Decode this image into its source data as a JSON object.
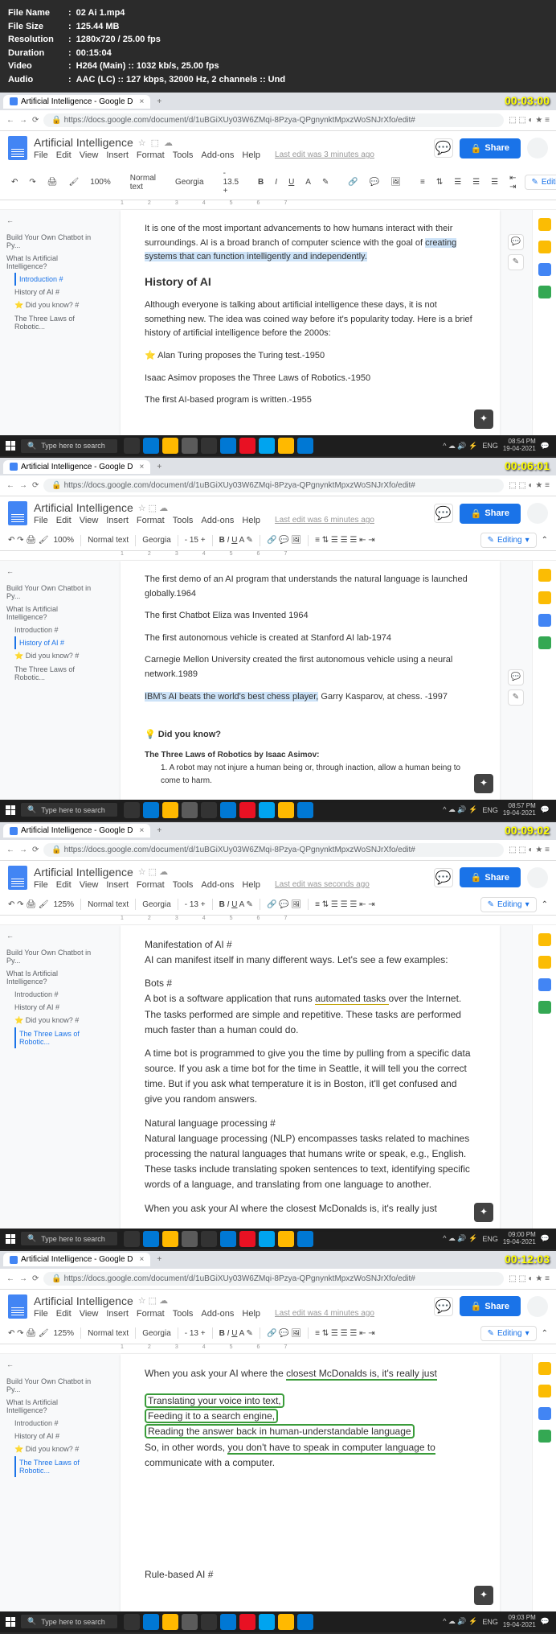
{
  "meta": {
    "file_name_label": "File Name",
    "file_name": "02 Ai 1.mp4",
    "file_size_label": "File Size",
    "file_size": "125.44 MB",
    "resolution_label": "Resolution",
    "resolution": "1280x720 / 25.00 fps",
    "duration_label": "Duration",
    "duration": "00:15:04",
    "video_label": "Video",
    "video": "H264 (Main) :: 1032 kb/s, 25.00 fps",
    "audio_label": "Audio",
    "audio": "AAC (LC) :: 127 kbps, 32000 Hz, 2 channels :: Und"
  },
  "timestamps": [
    "00:03:00",
    "00:06:01",
    "00:09:02",
    "00:12:03"
  ],
  "browser": {
    "tab_title": "Artificial Intelligence - Google D",
    "url": "https://docs.google.com/document/d/1uBGiXUy03W6ZMqi-8Pzya-QPgnynktMpxzWoSNJrXfo/edit#"
  },
  "docs": {
    "title": "Artificial Intelligence",
    "menu": [
      "File",
      "Edit",
      "View",
      "Insert",
      "Format",
      "Tools",
      "Add-ons",
      "Help"
    ],
    "last_edit": [
      "Last edit was 3 minutes ago",
      "Last edit was 6 minutes ago",
      "Last edit was seconds ago",
      "Last edit was 4 minutes ago"
    ],
    "share": "Share",
    "editing": "Editing",
    "zoom": [
      "100%",
      "100%",
      "125%",
      "125%"
    ],
    "style": "Normal text",
    "font": "Georgia",
    "size": [
      "13.5",
      "15",
      "13",
      "13"
    ]
  },
  "outline": {
    "items": [
      "Build Your Own Chatbot in Py...",
      "What Is Artificial Intelligence?",
      "Introduction #",
      "History of AI #",
      "Did you know? #",
      "The Three Laws of Robotic..."
    ]
  },
  "frame1": {
    "p1": "It is one of the most important advancements to how humans interact with their surroundings. AI is a broad branch of computer science with the goal of ",
    "p1_hl": "creating systems that can function intelligently and independently.",
    "h": "History of AI",
    "p2": "Although everyone is talking about artificial intelligence these days, it is not something new. The idea was coined way before it's popularity today. Here is a brief history of artificial intelligence before the 2000s:",
    "l1": "Alan Turing proposes the Turing test.-1950",
    "l2": "Isaac Asimov proposes the Three Laws of Robotics.-1950",
    "l3": "The first AI-based program is written.-1955"
  },
  "frame2": {
    "p1": "The first demo of an AI program that understands the natural language is launched globally.1964",
    "p2": "The first Chatbot Eliza was Invented 1964",
    "p3": "The first autonomous vehicle is created at Stanford AI lab-1974",
    "p4": "Carnegie Mellon University created the first autonomous vehicle using a neural network.1989",
    "p5_hl": "IBM's AI beats the world's best chess player,",
    "p5": " Garry Kasparov, at chess. -1997",
    "dyk": "Did you know?",
    "law_h": "The Three Laws of Robotics by Isaac Asimov:",
    "law1": "A robot may not injure a human being or, through inaction, allow a human being to come to harm."
  },
  "frame3": {
    "h1": "Manifestation of AI #",
    "p1": "AI can manifest itself in many different ways. Let's see a few examples:",
    "h2": "Bots #",
    "p2a": "A bot is a software application that runs ",
    "p2b": "automated tasks ",
    "p2c": "over the Internet. The tasks performed are simple and repetitive. These tasks are performed much faster than a human could do.",
    "p3": "A time bot is programmed to give you the time by pulling from a specific data source. If you ask a time bot for the time in Seattle, it will tell you the correct time. But if you ask what temperature it is in Boston, it'll get confused and give you random answers.",
    "h3": "Natural language processing #",
    "p4": "Natural language processing (NLP) encompasses tasks related to machines processing the natural languages that humans write or speak, e.g., English. These tasks include translating spoken sentences to text, identifying specific words of a language, and translating from one language to another.",
    "p5": "When you ask your AI where the closest McDonalds is, it's really just"
  },
  "frame4": {
    "p1": "When you ask your AI where the closest McDonalds is, it's really just",
    "l1": "Translating your voice into text,",
    "l2": "Feeding it to a search engine,",
    "l3": "Reading the answer back in human-understandable language",
    "p2a": "So, in other words, ",
    "p2b": "you don't have to speak in computer language to",
    "p2c": " communicate with a computer.",
    "h": "Rule-based AI #"
  },
  "taskbar": {
    "search": "Type here to search",
    "lang": "ENG",
    "times": [
      "08:54 PM",
      "08:57 PM",
      "09:00 PM",
      "09:03 PM"
    ],
    "date": "19-04-2021"
  }
}
